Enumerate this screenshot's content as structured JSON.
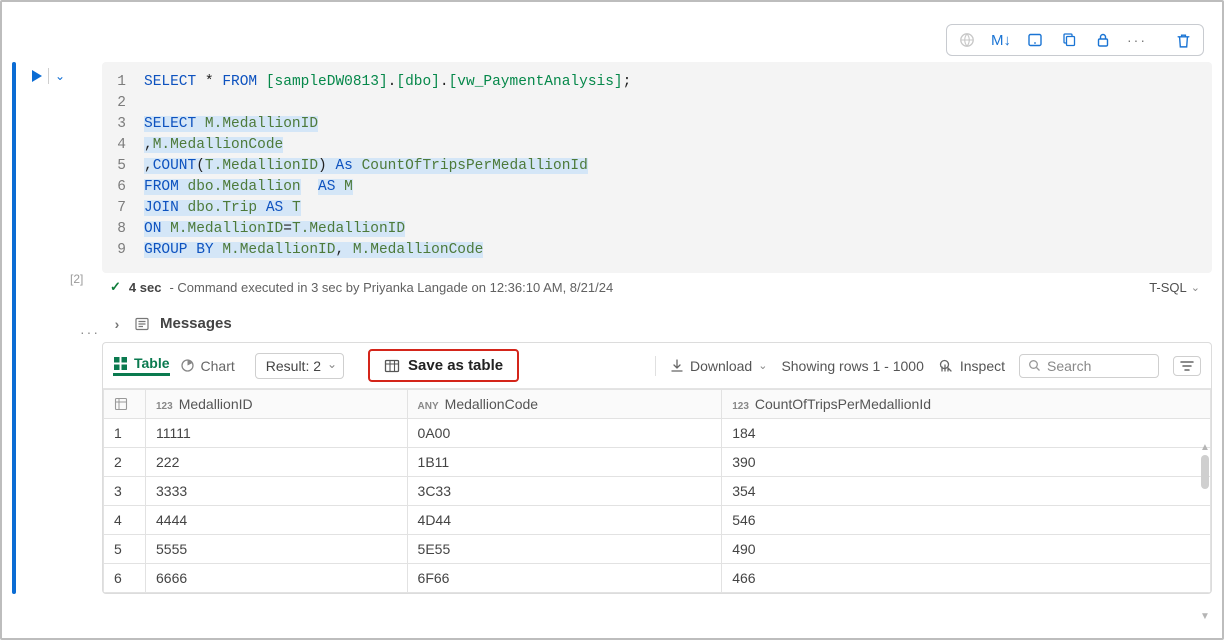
{
  "toolbar": {
    "markdown": "M↓"
  },
  "execIndex": "[2]",
  "code": {
    "lines": [
      {
        "n": "1",
        "html": "<span class='kw'>SELECT</span> <span class='plain'>*</span> <span class='kw'>FROM</span> <span class='name'>[sampleDW0813]</span><span class='plain'>.</span><span class='name'>[dbo]</span><span class='plain'>.</span><span class='name'>[vw_PaymentAnalysis]</span><span class='plain'>;</span>"
      },
      {
        "n": "2",
        "html": ""
      },
      {
        "n": "3",
        "html": "<span class='hl'><span class='kw'>SELECT</span>&nbsp;<span class='name2'>M.MedallionID</span></span>"
      },
      {
        "n": "4",
        "html": "<span class='hl'><span class='plain'>,</span><span class='name2'>M.MedallionCode</span></span>"
      },
      {
        "n": "5",
        "html": "<span class='hl'><span class='plain'>,</span><span class='kw'>COUNT</span><span class='plain'>(</span><span class='name2'>T.MedallionID</span><span class='plain'>)</span>&nbsp;<span class='kw'>As</span>&nbsp;<span class='name2'>CountOfTripsPerMedallionId</span></span>"
      },
      {
        "n": "6",
        "html": "<span class='hl'><span class='kw'>FROM</span>&nbsp;<span class='name2'>dbo.Medallion</span></span>&nbsp;&nbsp;<span class='hl'><span class='kw'>AS</span>&nbsp;<span class='name2'>M</span></span>"
      },
      {
        "n": "7",
        "html": "<span class='hl'><span class='kw'>JOIN</span>&nbsp;<span class='name2'>dbo.Trip</span>&nbsp;<span class='kw'>AS</span>&nbsp;<span class='name2'>T</span></span>"
      },
      {
        "n": "8",
        "html": "<span class='hl'><span class='kw'>ON</span>&nbsp;<span class='name2'>M.MedallionID</span><span class='plain'>=</span><span class='name2'>T.MedallionID</span></span>"
      },
      {
        "n": "9",
        "html": "<span class='hl'><span class='kw'>GROUP</span>&nbsp;<span class='kw'>BY</span>&nbsp;<span class='name2'>M.MedallionID</span><span class='plain'>,</span>&nbsp;<span class='name2'>M.MedallionCode</span></span>"
      }
    ]
  },
  "status": {
    "duration": "4 sec",
    "detail": "- Command executed in 3 sec by Priyanka Langade on 12:36:10 AM, 8/21/24",
    "language": "T-SQL"
  },
  "messagesLabel": "Messages",
  "results": {
    "tableLabel": "Table",
    "chartLabel": "Chart",
    "resultSelected": "Result: 2",
    "saveAsTable": "Save as table",
    "download": "Download",
    "rowRange": "Showing rows 1 - 1000",
    "inspect": "Inspect",
    "searchPlaceholder": "Search"
  },
  "columns": [
    {
      "type": "123",
      "name": "MedallionID"
    },
    {
      "type": "ANY",
      "name": "MedallionCode"
    },
    {
      "type": "123",
      "name": "CountOfTripsPerMedallionId"
    }
  ],
  "rows": [
    {
      "n": "1",
      "c": [
        "11111",
        "0A00",
        "184"
      ]
    },
    {
      "n": "2",
      "c": [
        "222",
        "1B11",
        "390"
      ]
    },
    {
      "n": "3",
      "c": [
        "3333",
        "3C33",
        "354"
      ]
    },
    {
      "n": "4",
      "c": [
        "4444",
        "4D44",
        "546"
      ]
    },
    {
      "n": "5",
      "c": [
        "5555",
        "5E55",
        "490"
      ]
    },
    {
      "n": "6",
      "c": [
        "6666",
        "6F66",
        "466"
      ]
    }
  ]
}
